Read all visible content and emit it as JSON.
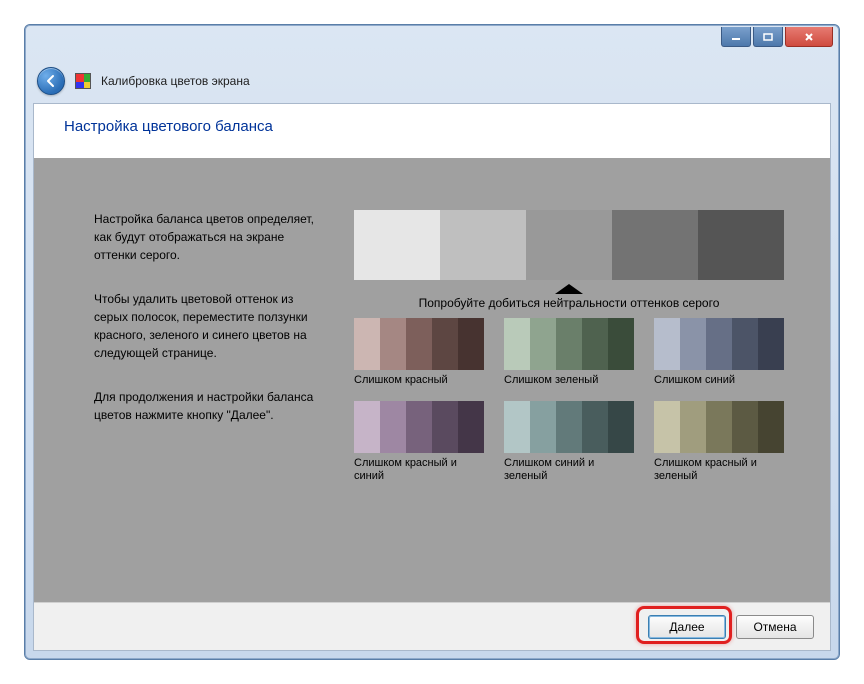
{
  "window_title": "Калибровка цветов экрана",
  "heading": "Настройка цветового баланса",
  "paragraphs": {
    "p1": "Настройка баланса цветов определяет, как будут отображаться на экране оттенки серого.",
    "p2": "Чтобы удалить цветовой оттенок из серых полосок, переместите ползунки красного, зеленого и синего цветов на следующей странице.",
    "p3": "Для продолжения и настройки баланса цветов нажмите кнопку \"Далее\"."
  },
  "neutral_label": "Попробуйте добиться нейтральности оттенков серого",
  "tints": [
    {
      "label": "Слишком красный",
      "colors": [
        "#ccb6b2",
        "#a58783",
        "#7d5f5b",
        "#5d4642",
        "#473330"
      ]
    },
    {
      "label": "Слишком зеленый",
      "colors": [
        "#b9cab9",
        "#8fa48f",
        "#6a7f6a",
        "#4f624f",
        "#3a4c3a"
      ]
    },
    {
      "label": "Слишком синий",
      "colors": [
        "#b6bdcc",
        "#8a93a8",
        "#666f86",
        "#4c5467",
        "#393f50"
      ]
    },
    {
      "label": "Слишком красный и синий",
      "colors": [
        "#c6b4c8",
        "#9e87a3",
        "#77627c",
        "#5a4a5f",
        "#443648"
      ]
    },
    {
      "label": "Слишком синий и зеленый",
      "colors": [
        "#b2c6c6",
        "#86a0a0",
        "#627a7a",
        "#495d5d",
        "#364747"
      ]
    },
    {
      "label": "Слишком красный и зеленый",
      "colors": [
        "#c6c3a8",
        "#a09d7e",
        "#7a785b",
        "#5c5a43",
        "#464431"
      ]
    }
  ],
  "buttons": {
    "next": "Далее",
    "cancel": "Отмена"
  }
}
